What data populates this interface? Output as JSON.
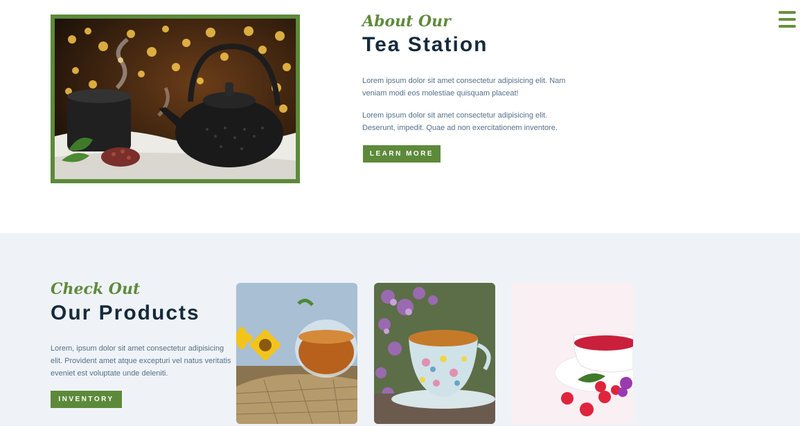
{
  "about": {
    "script_heading": "About Our",
    "title": "Tea Station",
    "paragraph1": "Lorem ipsum dolor sit amet consectetur adipisicing elit. Nam veniam modi eos molestiae quisquam placeat!",
    "paragraph2": "Lorem ipsum dolor sit amet consectetur adipisicing elit. Deserunt, impedit. Quae ad non exercitationem inventore.",
    "button_label": "LEARN MORE"
  },
  "products": {
    "script_heading": "Check Out",
    "title": "Our Products",
    "paragraph": "Lorem, ipsum dolor sit amet consectetur adipisicing elit. Provident amet atque excepturi vel natus veritatis eveniet est voluptate unde deleniti.",
    "button_label": "INVENTORY"
  },
  "colors": {
    "accent_green": "#5c8a3a",
    "heading_navy": "#152a3c",
    "body_text": "#56708a",
    "section_bg": "#eff3f7"
  },
  "icons": {
    "menu": "hamburger-menu-icon"
  }
}
